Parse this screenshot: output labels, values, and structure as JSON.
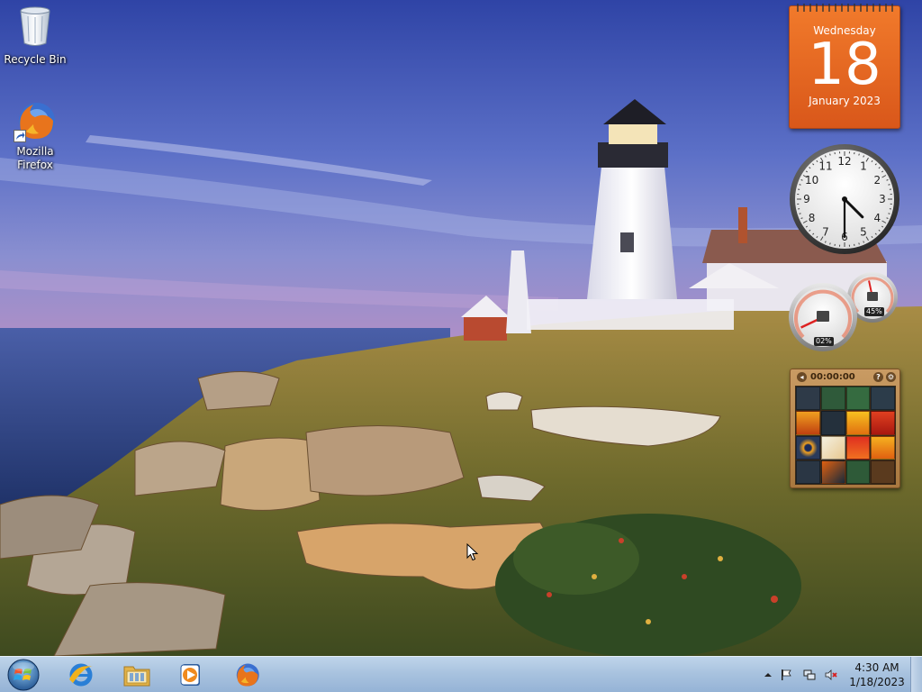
{
  "desktop": {
    "icons": [
      {
        "label": "Recycle Bin",
        "icon": "recycle-bin-icon"
      },
      {
        "label": "Mozilla Firefox",
        "icon": "firefox-icon"
      }
    ]
  },
  "gadgets": {
    "calendar": {
      "weekday": "Wednesday",
      "day": "18",
      "month_year": "January 2023",
      "color": "#e9692a"
    },
    "clock": {
      "hour": 4,
      "minute": 30,
      "numerals": [
        "12",
        "1",
        "2",
        "3",
        "4",
        "5",
        "6",
        "7",
        "8",
        "9",
        "10",
        "11"
      ]
    },
    "cpu_meter": {
      "cpu_label": "02%",
      "cpu_value": 2,
      "memory_label": "45%",
      "memory_value": 45
    },
    "puzzle": {
      "timer": "00:00:00",
      "help": "?",
      "settings": "⚙",
      "back": "◂"
    }
  },
  "taskbar": {
    "start_label": "Start",
    "pinned": [
      {
        "name": "Internet Explorer",
        "icon": "internet-explorer-icon"
      },
      {
        "name": "Windows Explorer",
        "icon": "folder-icon"
      },
      {
        "name": "Windows Media Player",
        "icon": "media-player-icon"
      },
      {
        "name": "Mozilla Firefox",
        "icon": "firefox-icon"
      }
    ],
    "tray": {
      "time": "4:30 AM",
      "date": "1/18/2023"
    }
  },
  "colors": {
    "sky_top": "#3447a8",
    "sky_mid": "#6b7fcf",
    "sea": "#2f4a8a",
    "grass": "#8b7a3a",
    "taskbar": "#a9c3df"
  }
}
